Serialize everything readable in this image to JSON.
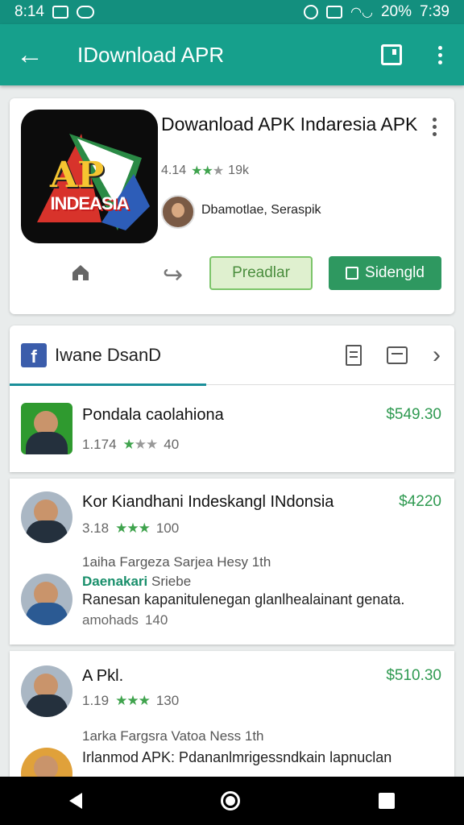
{
  "status_bar": {
    "time_left": "8:14",
    "battery": "20%",
    "time_right": "7:39"
  },
  "appbar": {
    "title": "IDownload APR"
  },
  "app": {
    "title": "Dowanload APK Indaresia APK",
    "rating": "4.14",
    "reviews": "19k",
    "developer": "Dbamotlae, Seraspik",
    "icon_text_main": "AP",
    "icon_text_sub": "INDEASIA",
    "button_secondary": "Preadlar",
    "button_primary": "Sidengld"
  },
  "list": {
    "title": "Iwane DsanD",
    "items": [
      {
        "title": "Pondala caolahiona",
        "price": "$549.30",
        "rating": "1.174",
        "count": "40"
      },
      {
        "title": "Kor Kiandhani Indeskangl INdonsia",
        "price": "$4220",
        "rating": "3.18",
        "count": "100",
        "line1": "1aiha Fargeza Sarjea Hesy 1th",
        "line2_green": "Daenakari",
        "line2_gray": "Sriebe",
        "line3": "Ranesan kapanitulenegan glanlhealainant genata.",
        "line4": "amohads",
        "line4_count": "140"
      },
      {
        "title": "A Pkl.",
        "price": "$510.30",
        "rating": "1.19",
        "count": "130",
        "line1": "1arka Fargsra Vatoa Ness 1th",
        "line2": "Irlanmod APK: Pdananlmrigessndkain lapnuclan"
      }
    ]
  },
  "colors": {
    "appbar": "#16a08c",
    "status_bar": "#138f7e",
    "accent_green": "#2e9860",
    "price_green": "#2f9a51"
  }
}
